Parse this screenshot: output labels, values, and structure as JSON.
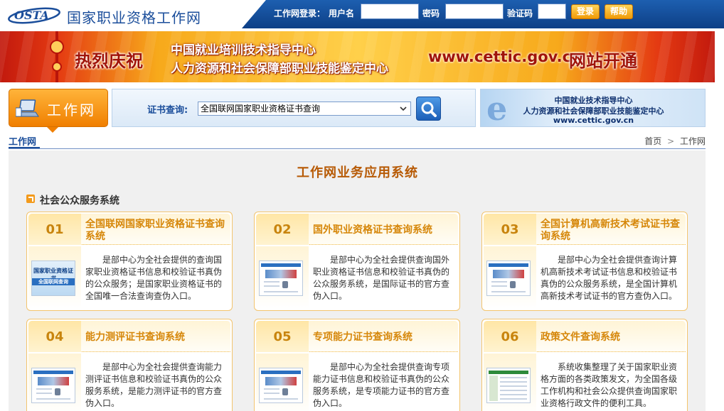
{
  "header": {
    "logo_text": "OSTA",
    "site_title": "国家职业资格工作网",
    "login_label": "工作网登录：",
    "username_label": "用户名",
    "password_label": "密码",
    "captcha_label": "验证码",
    "login_button": "登录",
    "help_button": "帮助"
  },
  "banner": {
    "celebrate": "热烈庆祝",
    "org_line1": "中国就业培训技术指导中心",
    "org_line2": "人力资源和社会保障部职业技能鉴定中心",
    "url": "www.cettic.gov.cn",
    "launch": "网站开通"
  },
  "nav": {
    "brand": "工作网",
    "search_label": "证书查询:",
    "search_selected": "全国联网国家职业资格证书查询",
    "cettic_line1": "中国就业技术指导中心",
    "cettic_line2": "人力资源和社会保障部职业技能鉴定中心",
    "cettic_line3": "www.cettic.gov.cn"
  },
  "breadcrumb": {
    "current": "工作网",
    "home": "首页",
    "separator": ">",
    "page": "工作网"
  },
  "main": {
    "title": "工作网业务应用系统",
    "section_title": "社会公众服务系统",
    "cards": [
      {
        "num": "01",
        "title": "全国联网国家职业资格证书查询系统",
        "desc": "是部中心为全社会提供的查询国家职业资格证书信息和校验证书真伪的公众服务；是国家职业资格证书的全国唯一合法查询查伪入口。",
        "thumb_line1": "国家职业资格证书",
        "thumb_line2": "全国联网查询"
      },
      {
        "num": "02",
        "title": "国外职业资格证书查询系统",
        "desc": "是部中心为全社会提供查询国外职业资格证书信息和校验证书真伪的公众服务系统，是国际证书的官方查伪入口。"
      },
      {
        "num": "03",
        "title": "全国计算机高新技术考试证书查询系统",
        "desc": "是部中心为全社会提供查询计算机高新技术考试证书信息和校验证书真伪的公众服务系统，是全国计算机高新技术考试证书的官方查伪入口。"
      },
      {
        "num": "04",
        "title": "能力测评证书查询系统",
        "desc": "是部中心为全社会提供查询能力测评证书信息和校验证书真伪的公众服务系统，是能力测评证书的官方查伪入口。"
      },
      {
        "num": "05",
        "title": "专项能力证书查询系统",
        "desc": "是部中心为全社会提供查询专项能力证书信息和校验证书真伪的公众服务系统，是专项能力证书的官方查伪入口。"
      },
      {
        "num": "06",
        "title": "政策文件查询系统",
        "desc": "系统收集整理了关于国家职业资格方面的各类政策发文，为全国各级工作机构和社会公众提供查询国家职业资格行政文件的便利工具。"
      }
    ]
  },
  "colors": {
    "header_blue": "#0d3f86",
    "accent_orange": "#f07f00",
    "title_orange": "#b75a05",
    "card_border": "#f3c46d"
  }
}
